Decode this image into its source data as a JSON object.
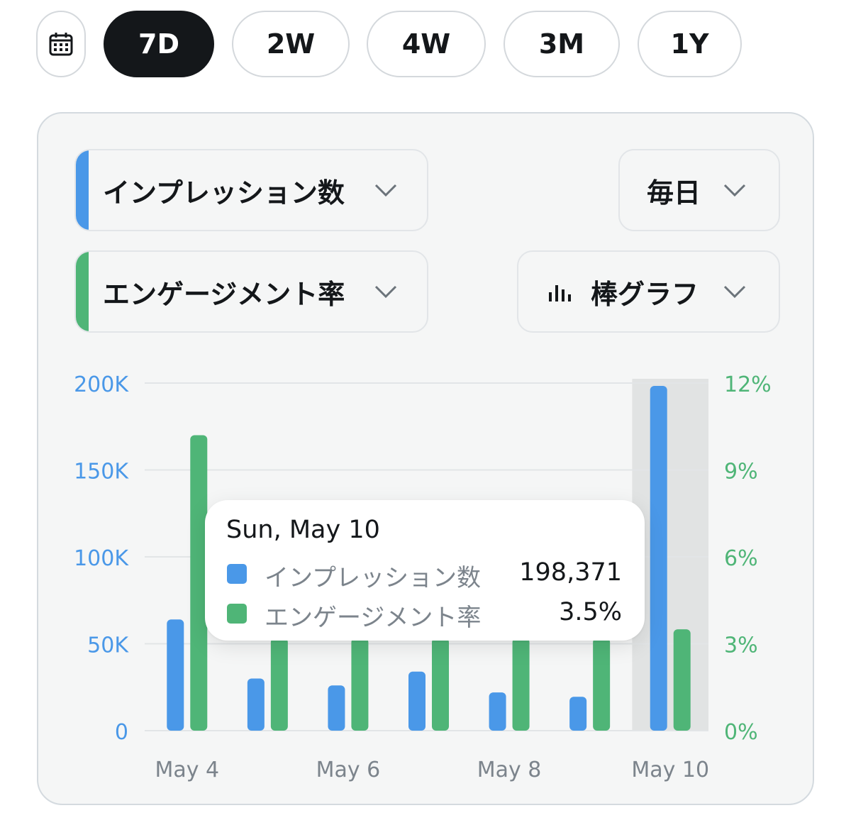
{
  "range_buttons": [
    "7D",
    "2W",
    "4W",
    "3M",
    "1Y"
  ],
  "active_range": "7D",
  "controls": {
    "metric1": "インプレッション数",
    "metric2": "エンゲージメント率",
    "interval": "毎日",
    "chart_type": "棒グラフ"
  },
  "colors": {
    "impressions": "#4a98e8",
    "engagement": "#4fb577",
    "left_axis": "#4a98e8",
    "right_axis": "#4fb577",
    "active_button": "#14171a"
  },
  "tooltip": {
    "date": "Sun, May 10",
    "rows": [
      {
        "label": "インプレッション数",
        "value": "198,371"
      },
      {
        "label": "エンゲージメント率",
        "value": "3.5%"
      }
    ]
  },
  "chart_data": {
    "type": "bar",
    "categories": [
      "May 4",
      "May 5",
      "May 6",
      "May 7",
      "May 8",
      "May 9",
      "May 10"
    ],
    "x_tick_labels": [
      "May 4",
      "May 6",
      "May 8",
      "May 10"
    ],
    "series": [
      {
        "name": "インプレッション数",
        "axis": "left",
        "values": [
          64000,
          30000,
          26000,
          34000,
          22000,
          19500,
          198371
        ]
      },
      {
        "name": "エンゲージメント率",
        "axis": "right",
        "values": [
          10.2,
          3.2,
          3.2,
          3.2,
          3.2,
          3.2,
          3.5
        ]
      }
    ],
    "y_left": {
      "ticks": [
        "0",
        "50K",
        "100K",
        "150K",
        "200K"
      ],
      "range": [
        0,
        200000
      ]
    },
    "y_right": {
      "ticks": [
        "0%",
        "3%",
        "6%",
        "9%",
        "12%"
      ],
      "range": [
        0,
        12
      ]
    },
    "highlighted_category": "May 10",
    "grid": true
  }
}
